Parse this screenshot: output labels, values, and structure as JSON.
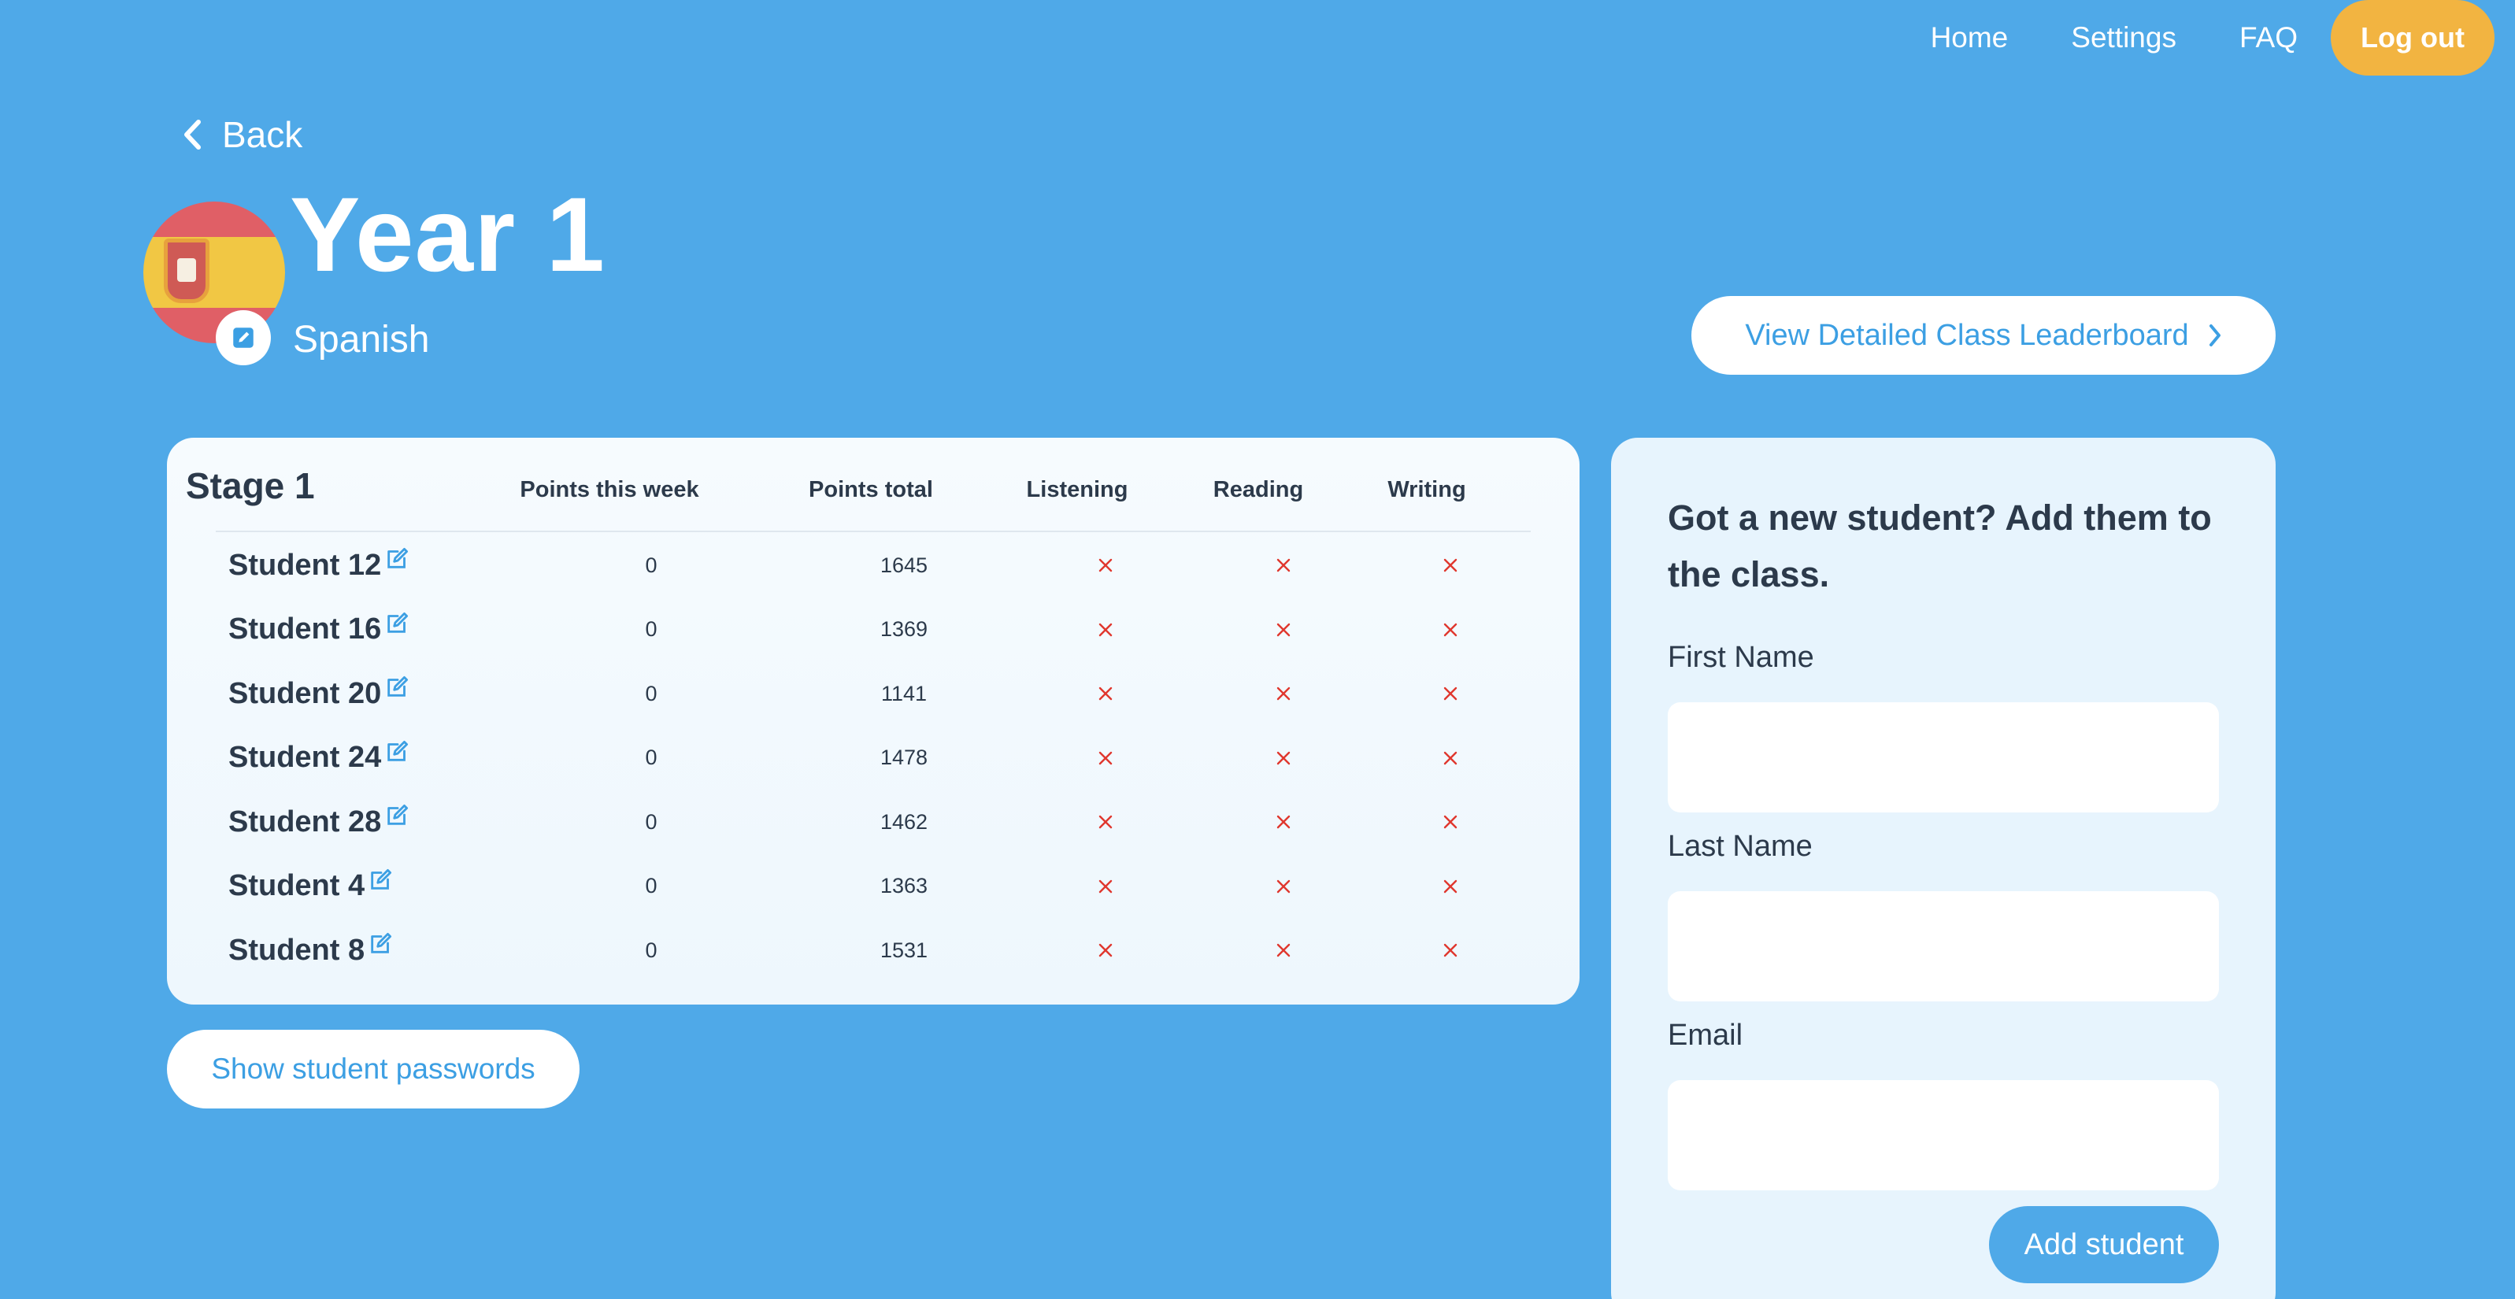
{
  "nav": {
    "home": "Home",
    "settings": "Settings",
    "faq": "FAQ",
    "logout": "Log out"
  },
  "header": {
    "back_label": "Back",
    "class_title": "Year 1",
    "language": "Spanish",
    "leaderboard_button": "View Detailed Class Leaderboard"
  },
  "table": {
    "stage": "Stage 1",
    "columns": [
      "Points this week",
      "Points total",
      "Listening",
      "Reading",
      "Writing"
    ],
    "rows": [
      {
        "name": "Student 12",
        "week": "0",
        "total": "1645"
      },
      {
        "name": "Student 16",
        "week": "0",
        "total": "1369"
      },
      {
        "name": "Student 20",
        "week": "0",
        "total": "1141"
      },
      {
        "name": "Student 24",
        "week": "0",
        "total": "1478"
      },
      {
        "name": "Student 28",
        "week": "0",
        "total": "1462"
      },
      {
        "name": "Student 4",
        "week": "0",
        "total": "1363"
      },
      {
        "name": "Student 8",
        "week": "0",
        "total": "1531"
      }
    ],
    "status_icon": "cross-icon"
  },
  "passwords_button": "Show student passwords",
  "add_student": {
    "heading": "Got a new student? Add them to the class.",
    "first_name_label": "First Name",
    "first_name_value": "",
    "last_name_label": "Last Name",
    "last_name_value": "",
    "email_label": "Email",
    "email_value": "",
    "submit": "Add student"
  },
  "colors": {
    "background": "#4fa9e8",
    "accent_orange": "#f2b441",
    "link_blue": "#3c9fe3",
    "cross_red": "#e0372e"
  }
}
